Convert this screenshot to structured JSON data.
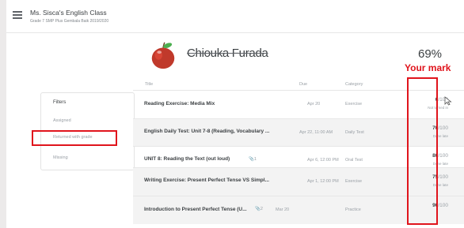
{
  "header": {
    "class_title": "Ms. Sisca's English Class",
    "class_subtitle": "Grade 7 SMP Plus Gembala Baik 2019/2020"
  },
  "student": {
    "name": "Chiouka Furada",
    "percent": "69%",
    "annotation": "Your mark"
  },
  "filters": {
    "title": "Filters",
    "items": [
      "Assigned",
      "Returned with grade",
      "Missing"
    ]
  },
  "columns": {
    "title": "Title",
    "due": "Due",
    "category": "Category"
  },
  "rows": [
    {
      "title": "Reading Exercise: Media Mix",
      "attach": "",
      "due": "Apr 20",
      "category": "Exercise",
      "score": "0",
      "max": "/100",
      "status": "Not turned in"
    },
    {
      "title": "English Daily Test: Unit 7-8 (Reading, Vocabulary ...",
      "attach": "",
      "due": "Apr 22, 11:00 AM",
      "category": "Daily Test",
      "score": "70",
      "max": "/100",
      "status": "Done late"
    },
    {
      "title": "UNIT 8: Reading the Text (out loud)",
      "attach": "1",
      "due": "Apr 6, 12:00 PM",
      "category": "Oral Test",
      "score": "80",
      "max": "/100",
      "status": "Done late"
    },
    {
      "title": "Writing Exercise: Present Perfect Tense VS Simpl...",
      "attach": "",
      "due": "Apr 1, 12:00 PM",
      "category": "Exercise",
      "score": "75",
      "max": "/100",
      "status": "Done late"
    },
    {
      "title": "Introduction to Present Perfect Tense (U...",
      "attach": "2",
      "due": "Mar 20",
      "category": "Practice",
      "score": "90",
      "max": "/100",
      "status": ""
    }
  ],
  "colors": {
    "highlight": "#e0141c",
    "text": "#3c4043",
    "muted": "#9aa0a6"
  }
}
